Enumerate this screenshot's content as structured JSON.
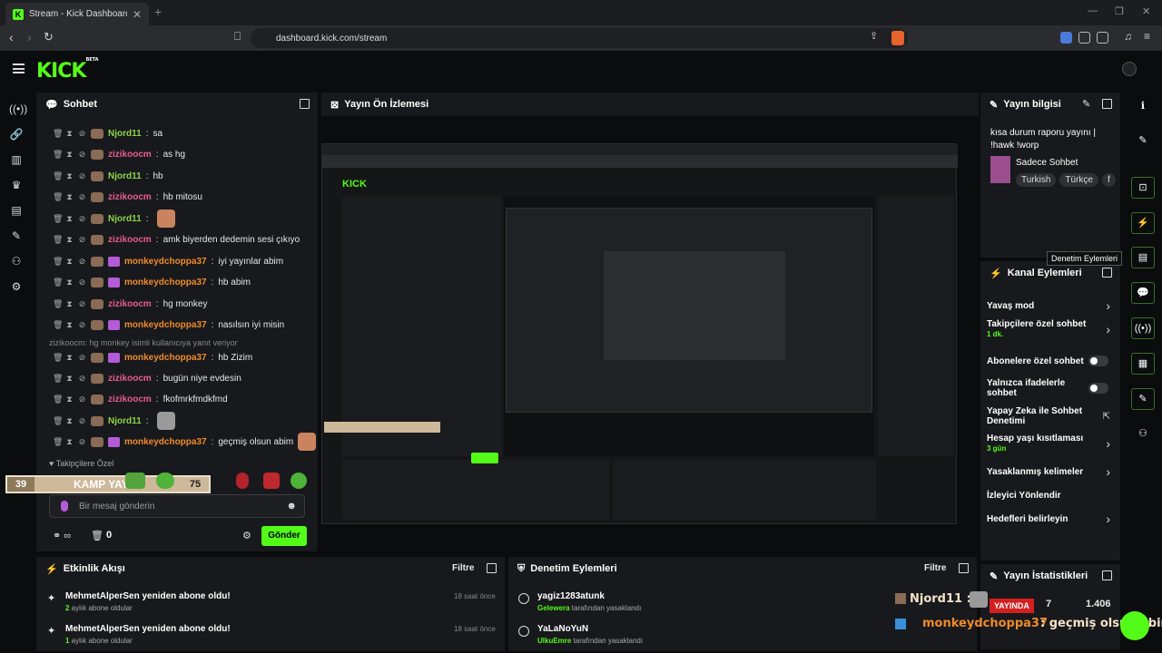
{
  "browser": {
    "tab_title": "Stream - Kick Dashboard",
    "url": "dashboard.kick.com/stream"
  },
  "brand": {
    "logo": "KICK",
    "logo_badge": "BETA",
    "accent": "#53fc18"
  },
  "chat": {
    "title": "Sohbet",
    "messages": [
      {
        "user": "Njord11",
        "color": "green",
        "text": "sa"
      },
      {
        "user": "zizikoocm",
        "color": "pink",
        "text": "as hg"
      },
      {
        "user": "Njord11",
        "color": "green",
        "text": "hb"
      },
      {
        "user": "zizikoocm",
        "color": "pink",
        "text": "hb mitosu"
      },
      {
        "user": "Njord11",
        "color": "green",
        "text": ""
      },
      {
        "user": "zizikoocm",
        "color": "pink",
        "text": "amk biyerden dedemin sesi çıkıyo"
      },
      {
        "user": "monkeydchoppa37",
        "color": "orange",
        "text": "iyi yayınlar abim"
      },
      {
        "user": "monkeydchoppa37",
        "color": "orange",
        "text": "hb abim"
      },
      {
        "user": "zizikoocm",
        "color": "pink",
        "text": "hg monkey"
      },
      {
        "user": "monkeydchoppa37",
        "color": "orange",
        "text": "nasılsın iyi misin"
      },
      {
        "user": "monkeydchoppa37",
        "color": "orange",
        "text": "hb Zizim"
      },
      {
        "user": "zizikoocm",
        "color": "pink",
        "text": "bugün niye evdesin"
      },
      {
        "user": "zizikoocm",
        "color": "pink",
        "text": "fkofmrkfmdkfmd"
      },
      {
        "user": "Njord11",
        "color": "green",
        "text": ""
      },
      {
        "user": "monkeydchoppa37",
        "color": "orange",
        "text": "geçmiş olsun abim"
      }
    ],
    "reply_note": "zizikoocm: hg monkey isimli kullanıcıya yanıt veriyor",
    "pinned_label": "Takipçilere Özel",
    "goal": {
      "left": "39",
      "label": "KAMP YAYINI",
      "right": "75"
    },
    "input_placeholder": "Bir mesaj gönderin",
    "send_label": "Gönder",
    "footer_count": "0"
  },
  "preview": {
    "title": "Yayın Ön İzlemesi"
  },
  "stream_info": {
    "title": "Yayın bilgisi",
    "stream_title": "kısa durum raporu yayını | !hawk !worp",
    "category": "Sadece Sohbet",
    "tags": [
      "Turkish",
      "Türkçe",
      "f"
    ]
  },
  "channel_actions": {
    "title": "Kanal Eylemleri",
    "tooltip": "Denetim Eylemleri",
    "rows": [
      {
        "label": "Yavaş mod",
        "sub": "",
        "ctrl": "chevron"
      },
      {
        "label": "Takipçilere özel sohbet",
        "sub": "1 dk.",
        "ctrl": "chevron"
      },
      {
        "label": "Abonelere özel sohbet",
        "sub": "",
        "ctrl": "toggle"
      },
      {
        "label": "Yalnızca ifadelerle sohbet",
        "sub": "",
        "ctrl": "toggle"
      },
      {
        "label": "Yapay Zeka ile Sohbet Denetimi",
        "sub": "",
        "ctrl": "ext"
      },
      {
        "label": "Hesap yaşı kısıtlaması",
        "sub": "3 gün",
        "ctrl": "chevron"
      },
      {
        "label": "Yasaklanmış kelimeler",
        "sub": "",
        "ctrl": "chevron"
      },
      {
        "label": "İzleyici Yönlendir",
        "sub": "",
        "ctrl": "none"
      },
      {
        "label": "Hedefleri belirleyin",
        "sub": "",
        "ctrl": "chevron"
      }
    ]
  },
  "stream_stats": {
    "title": "Yayın İstatistikleri",
    "live": "YAYINDA",
    "viewers": "7",
    "followers": "1.406"
  },
  "activity": {
    "title": "Etkinlik Akışı",
    "filter": "Filtre",
    "items": [
      {
        "text": "MehmetAlperSen yeniden abone oldu!",
        "num": "2",
        "sub": " aylık abone oldular",
        "ago": "18 saat önce"
      },
      {
        "text": "MehmetAlperSen yeniden abone oldu!",
        "num": "1",
        "sub": " aylık abone oldular",
        "ago": "18 saat önce"
      }
    ]
  },
  "moderation": {
    "title": "Denetim Eylemleri",
    "filter": "Filtre",
    "items": [
      {
        "user": "yagiz1283atunk",
        "by": "Gelewera",
        "sub": " tarafından yasaklandı"
      },
      {
        "user": "YaLaNoYuN",
        "by": "UlkuEmre",
        "sub": " tarafından yasaklandı"
      }
    ]
  },
  "overlay": {
    "line1_user": "Njord11",
    "line2_user": "monkeydchoppa37",
    "line2_text": "geçmiş olsun abim"
  }
}
